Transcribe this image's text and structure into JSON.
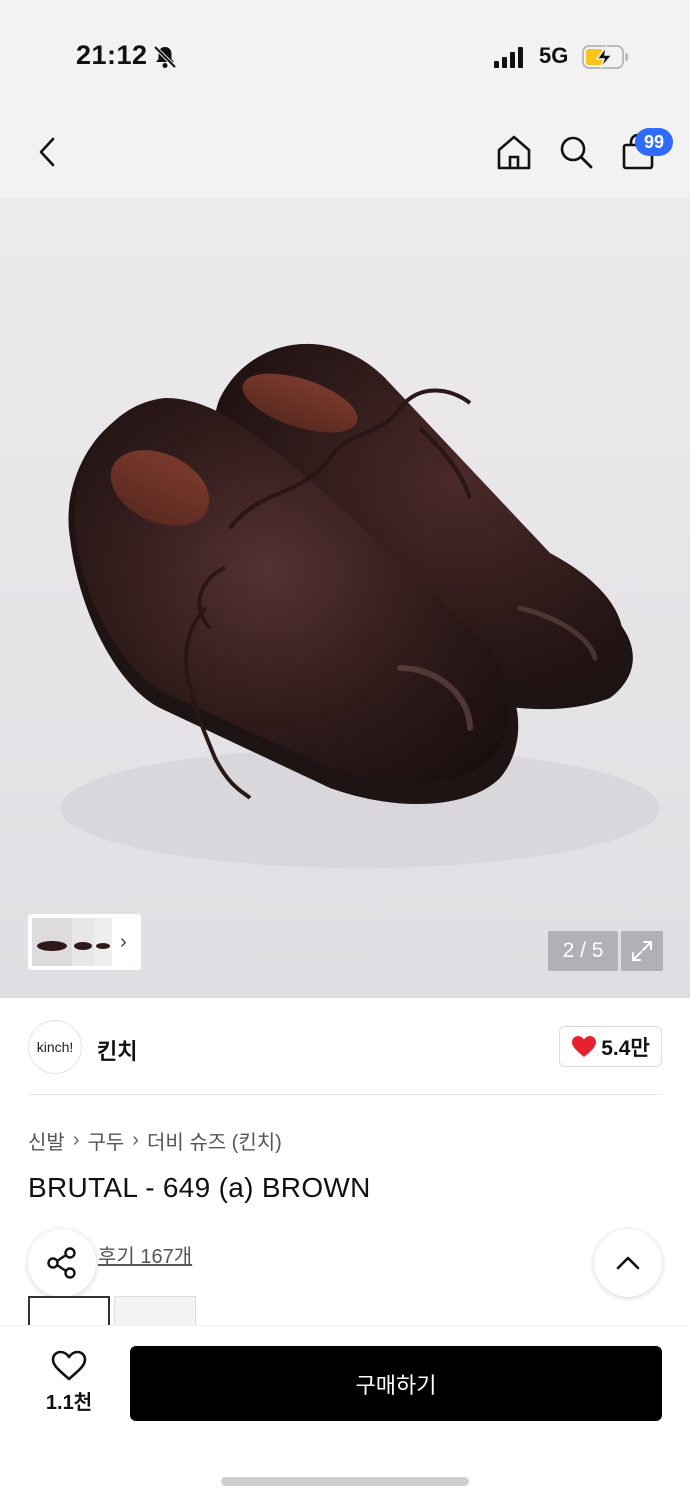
{
  "status_bar": {
    "time": "21:12",
    "network": "5G",
    "icons": [
      "bell-slash-icon",
      "signal-icon",
      "battery-charging-icon"
    ]
  },
  "nav": {
    "icons": [
      "back-chevron-icon",
      "home-icon",
      "search-icon",
      "shopping-bag-icon"
    ],
    "cart_count": "99"
  },
  "gallery": {
    "counter": "2 / 5",
    "thumbnail_next": "›",
    "icons": [
      "expand-icon"
    ]
  },
  "brand": {
    "logo_text": "kinch!",
    "name": "킨치",
    "like_count": "5.4만",
    "like_color": "#e8212e"
  },
  "product": {
    "breadcrumb": [
      "신발",
      "구두",
      "더비 슈즈 (킨치)"
    ],
    "breadcrumb_separator": "›",
    "title": "BRUTAL - 649 (a) BROWN",
    "review_link": "후기 167개"
  },
  "bottom_bar": {
    "wish_count": "1.1천",
    "buy_label": "구매하기",
    "buy_color": "#000000",
    "badge_color": "#2f6bff"
  }
}
